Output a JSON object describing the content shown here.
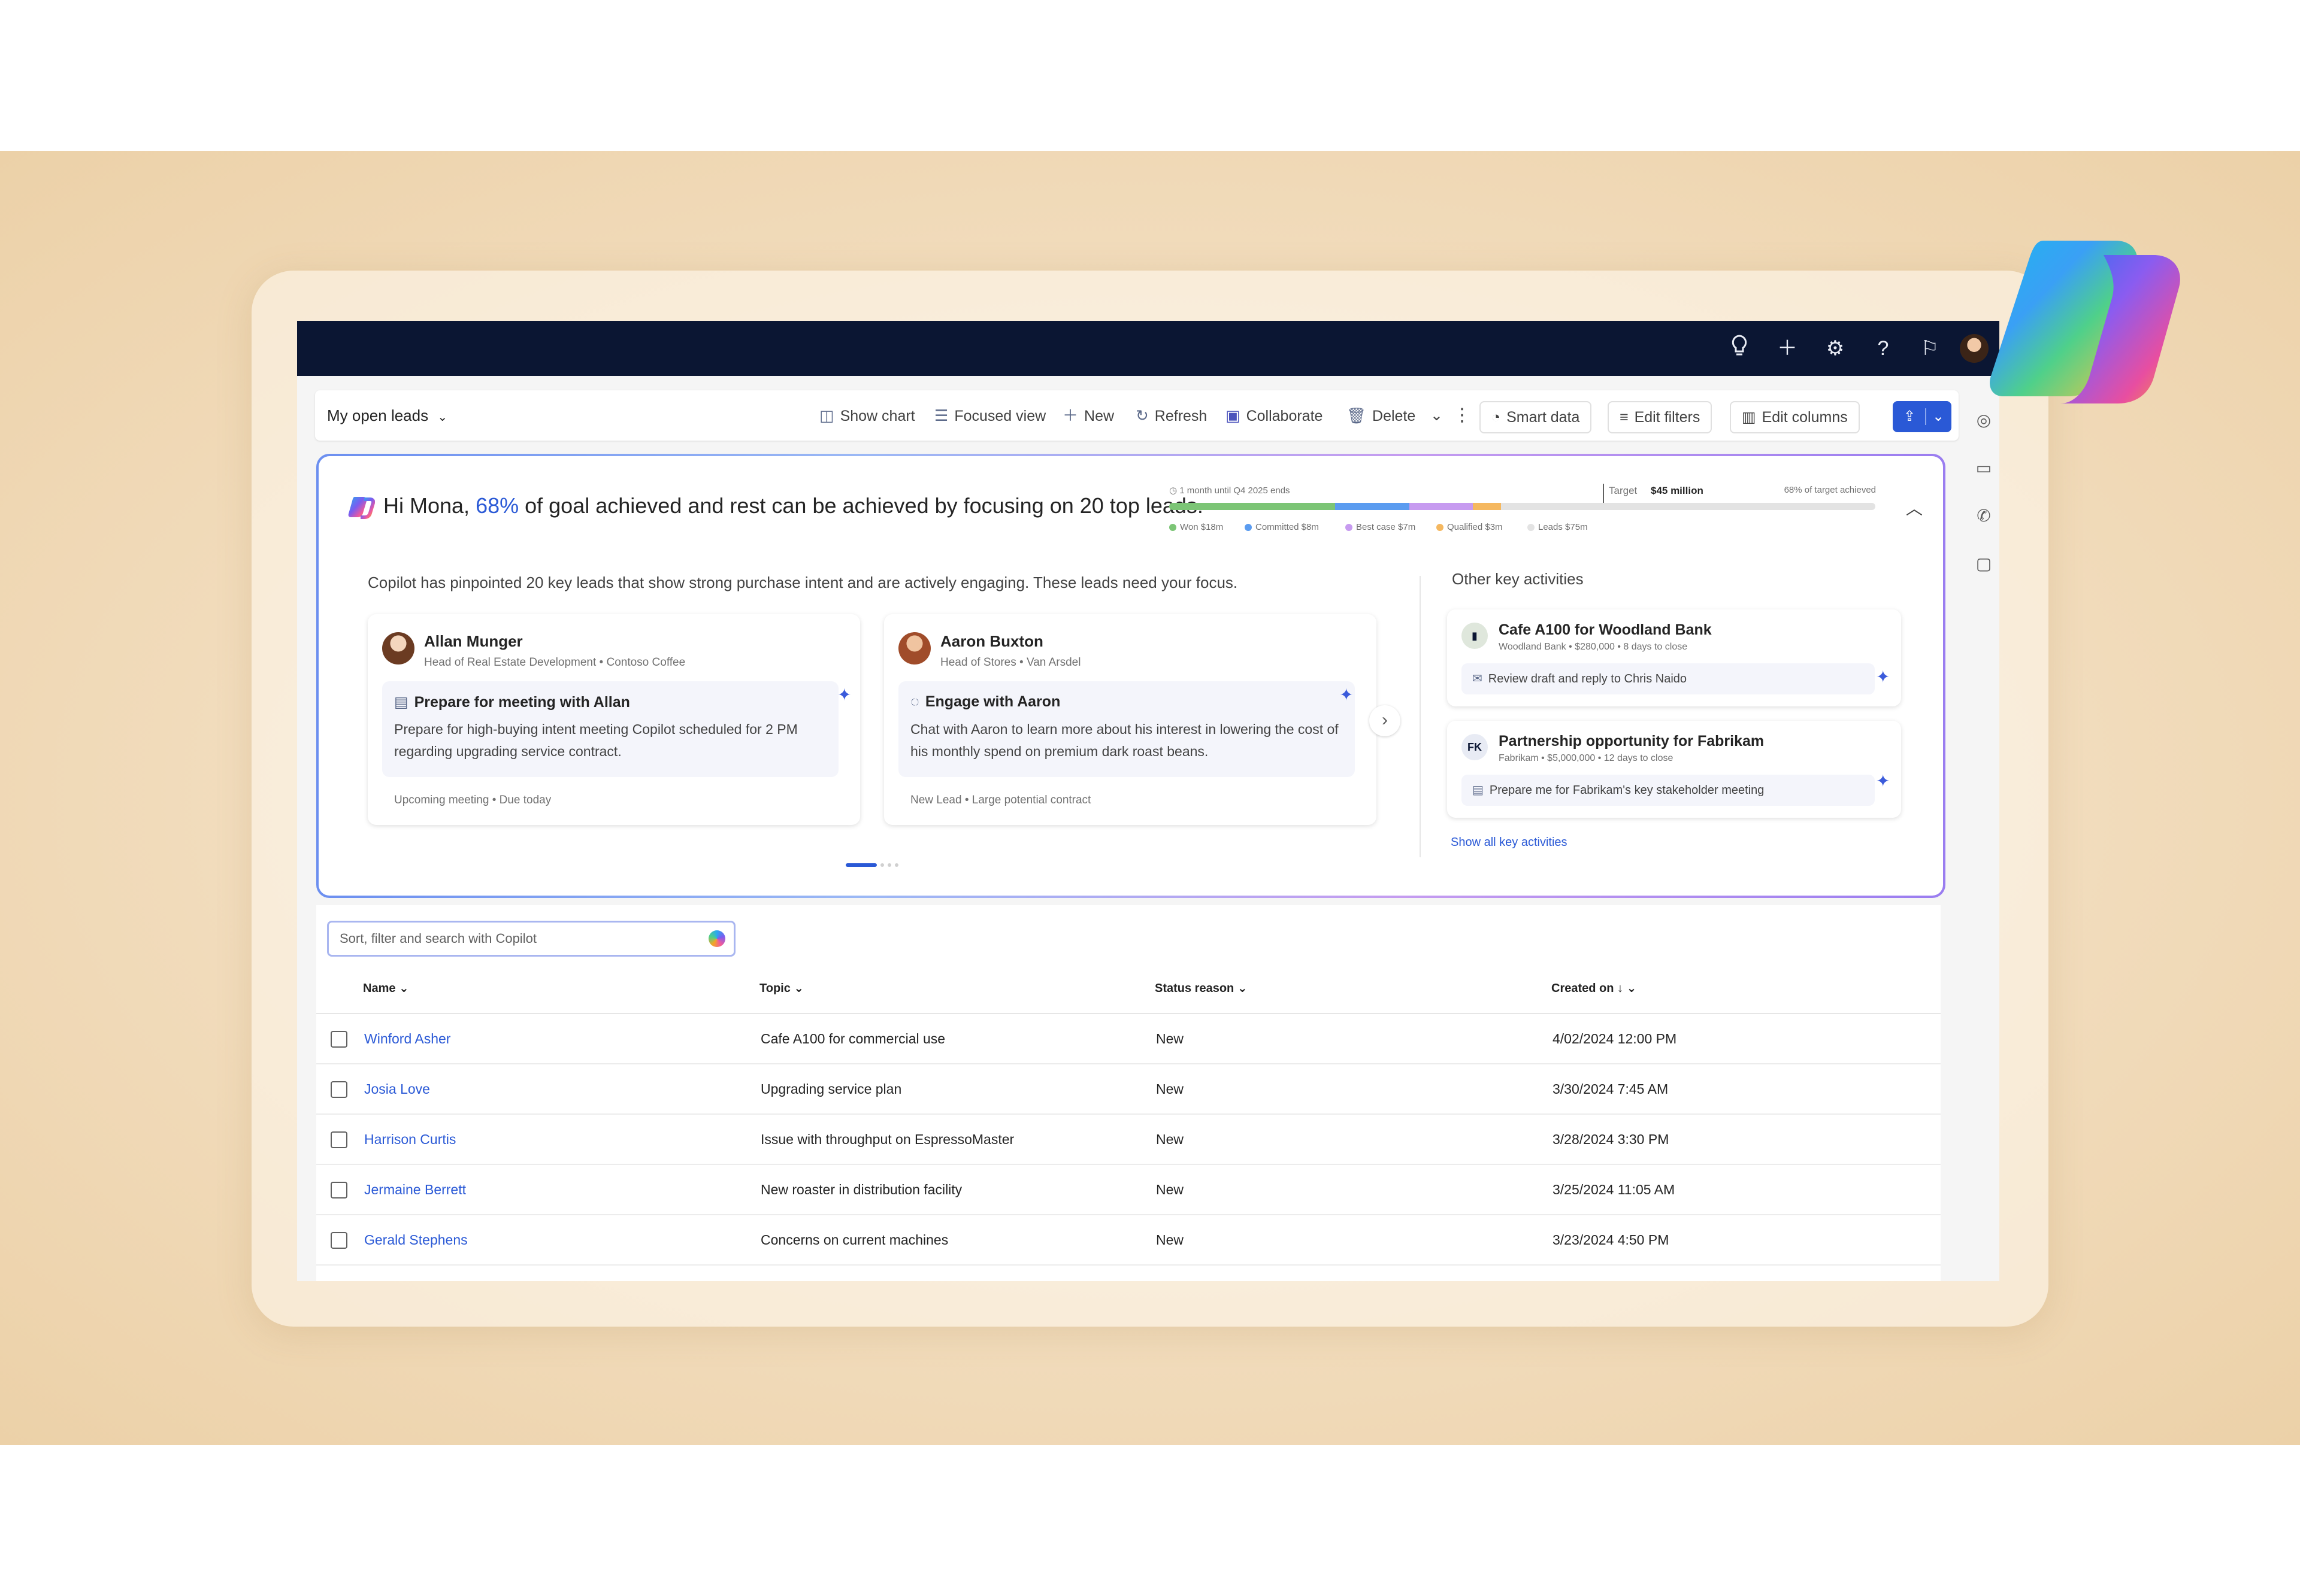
{
  "topbar": {
    "icons": [
      "lightbulb-icon",
      "plus-icon",
      "settings-icon",
      "help-icon",
      "feedback-icon",
      "avatar"
    ]
  },
  "commandbar": {
    "view_selector": "My open leads",
    "commands": {
      "show_chart": "Show chart",
      "focused_view": "Focused view",
      "new": "New",
      "refresh": "Refresh",
      "collaborate": "Collaborate",
      "delete": "Delete",
      "smart_data": "Smart data",
      "edit_filters": "Edit filters",
      "edit_columns": "Edit columns"
    }
  },
  "copilot": {
    "greeting_prefix": "Hi Mona, ",
    "greeting_pct": "68%",
    "greeting_suffix": " of goal achieved and rest can be achieved by focusing on 20 top leads.",
    "progress": {
      "timeframe": "1 month until Q4 2025 ends",
      "target_label": "Target",
      "target_value": "$45 million",
      "achieved_text": "68% of target achieved",
      "segments": [
        {
          "label": "Won $18m",
          "color": "#7cc576",
          "fraction": 0.235
        },
        {
          "label": "Committed $8m",
          "color": "#5b9cf0",
          "fraction": 0.105
        },
        {
          "label": "Best case $7m",
          "color": "#c79bf0",
          "fraction": 0.09
        },
        {
          "label": "Qualified $3m",
          "color": "#f5b860",
          "fraction": 0.04
        },
        {
          "label": "Leads $75m",
          "color": "#e3e3e3",
          "fraction": 0.53
        }
      ]
    },
    "intro": "Copilot has pinpointed 20 key leads that show strong purchase intent and are actively engaging. These leads need your focus.",
    "leads": [
      {
        "name": "Allan Munger",
        "subtitle": "Head of Real Estate Development • Contoso Coffee",
        "action_title": "Prepare for meeting with Allan",
        "action_desc": "Prepare for high-buying intent meeting Copilot scheduled for 2 PM regarding upgrading service contract.",
        "footer": "Upcoming meeting • Due today"
      },
      {
        "name": "Aaron Buxton",
        "subtitle": "Head of Stores • Van Arsdel",
        "action_title": "Engage with Aaron",
        "action_desc": "Chat with Aaron to learn more about his interest in lowering the cost of his monthly spend on premium dark roast beans.",
        "footer": "New Lead • Large potential contract"
      }
    ],
    "other_activities_title": "Other key activities",
    "activities": [
      {
        "name": "Cafe A100 for Woodland Bank",
        "subtitle": "Woodland Bank • $280,000 • 8 days to close",
        "action": "Review draft and reply to Chris Naido",
        "logo_text": ""
      },
      {
        "name": "Partnership opportunity for Fabrikam",
        "subtitle": "Fabrikam • $5,000,000 • 12 days to close",
        "action": "Prepare me for Fabrikam's key stakeholder meeting",
        "logo_text": "FK"
      }
    ],
    "show_all": "Show all key activities"
  },
  "grid": {
    "search_placeholder": "Sort, filter and search with Copilot",
    "columns": {
      "name": "Name",
      "topic": "Topic",
      "status": "Status reason",
      "created": "Created on"
    },
    "rows": [
      {
        "name": "Winford Asher",
        "topic": "Cafe A100 for commercial use",
        "status": "New",
        "created": "4/02/2024 12:00 PM"
      },
      {
        "name": "Josia Love",
        "topic": "Upgrading service plan",
        "status": "New",
        "created": "3/30/2024 7:45 AM"
      },
      {
        "name": "Harrison Curtis",
        "topic": "Issue with throughput on EspressoMaster",
        "status": "New",
        "created": "3/28/2024 3:30 PM"
      },
      {
        "name": "Jermaine Berrett",
        "topic": "New roaster in distribution facility",
        "status": "New",
        "created": "3/25/2024 11:05 AM"
      },
      {
        "name": "Gerald Stephens",
        "topic": "Concerns on current machines",
        "status": "New",
        "created": "3/23/2024 4:50 PM"
      }
    ]
  }
}
